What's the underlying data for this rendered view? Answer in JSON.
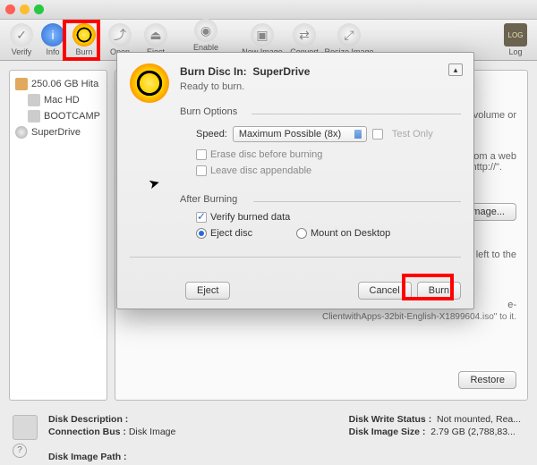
{
  "toolbar": {
    "items": [
      "Verify",
      "Info",
      "Burn",
      "Open",
      "Eject",
      "Enable Journaling",
      "New Image",
      "Convert",
      "Resize Image"
    ],
    "log": "Log"
  },
  "sidebar": {
    "disk": "250.06 GB Hita",
    "vol1": "Mac HD",
    "vol2": "BOOTCAMP",
    "drive": "SuperDrive"
  },
  "main": {
    "hint1": "volume or",
    "hint2a": "from a web",
    "hint2b": "\"http://\".",
    "image_btn": "Image...",
    "left1": "the left to the",
    "client": "ClientwithApps-32bit-English-X1899604.iso\" to it.",
    "restore_btn": "Restore",
    "iso_suffix": "e-"
  },
  "dialog": {
    "title_prefix": "Burn Disc In:",
    "drive": "SuperDrive",
    "status": "Ready to burn.",
    "section1": "Burn Options",
    "speed_label": "Speed:",
    "speed_value": "Maximum Possible (8x)",
    "test_only": "Test Only",
    "erase": "Erase disc before burning",
    "appendable": "Leave disc appendable",
    "section2": "After Burning",
    "verify": "Verify burned data",
    "eject_disc": "Eject disc",
    "mount": "Mount on Desktop",
    "eject_btn": "Eject",
    "cancel_btn": "Cancel",
    "burn_btn": "Burn"
  },
  "bottom": {
    "desc_label": "Disk Description :",
    "bus_label": "Connection Bus :",
    "bus_value": "Disk Image",
    "path_label": "Disk Image Path :",
    "write_label": "Disk Write Status :",
    "write_value": "Not mounted, Rea...",
    "size_label": "Disk Image Size :",
    "size_value": "2.79 GB (2,788,83..."
  }
}
